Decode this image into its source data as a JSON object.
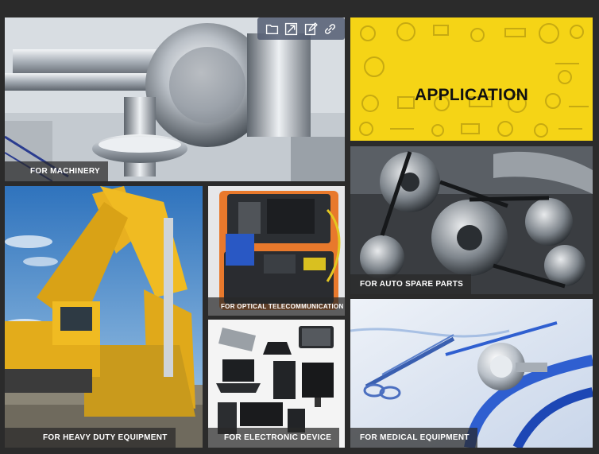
{
  "toolbar": {
    "buttons": [
      {
        "name": "folder-icon"
      },
      {
        "name": "resize-icon"
      },
      {
        "name": "edit-icon"
      },
      {
        "name": "link-icon"
      }
    ]
  },
  "tiles": {
    "machinery": {
      "caption": "FOR MACHINERY"
    },
    "application": {
      "title": "APPLICATION"
    },
    "auto_parts": {
      "caption": "FOR AUTO SPARE PARTS"
    },
    "heavy_duty": {
      "caption": "FOR HEAVY DUTY EQUIPMENT"
    },
    "optical": {
      "caption": "FOR OPTICAL TELECOMMUNICATION"
    },
    "electronic": {
      "caption": "FOR ELECTRONIC DEVICE"
    },
    "medical": {
      "caption": "FOR MEDICAL EQUIPMENT"
    }
  },
  "colors": {
    "background": "#2b2b2b",
    "application_yellow": "#f5d416",
    "caption_bg": "rgba(40,40,40,0.72)",
    "excavator_yellow": "#e8b020",
    "sky_blue": "#3f86c9",
    "medical_blue": "#2f5fd0"
  }
}
